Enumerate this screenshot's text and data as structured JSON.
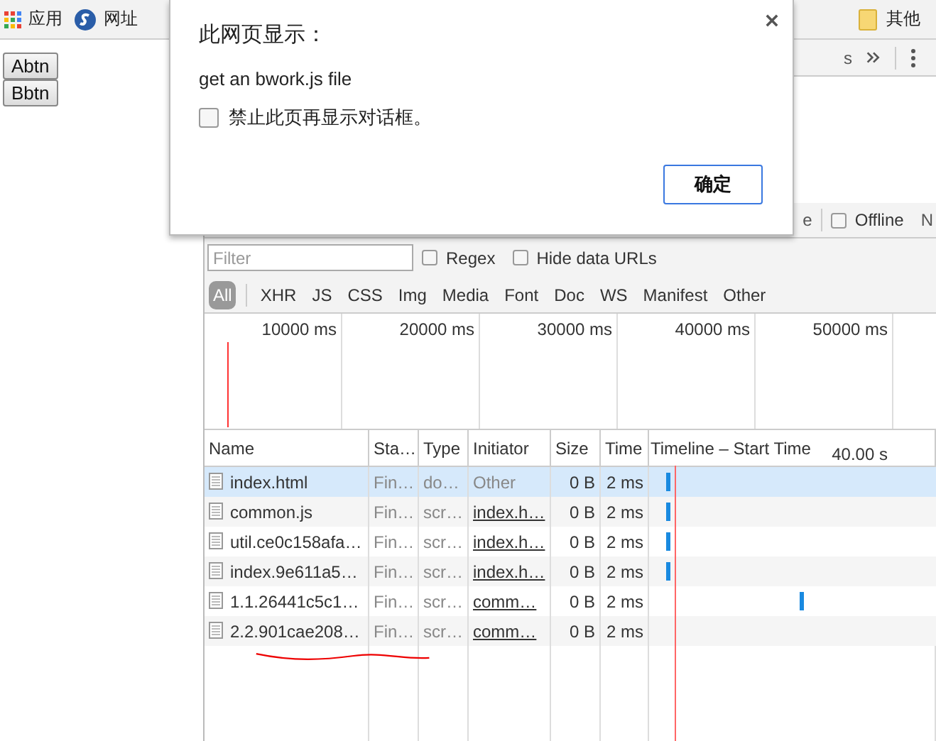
{
  "bookmarks": {
    "left": [
      {
        "kind": "apps",
        "label": "应用"
      },
      {
        "kind": "globe",
        "label": "网址"
      }
    ],
    "right": [
      {
        "kind": "folder",
        "label": "其他"
      }
    ]
  },
  "page_buttons": [
    "Abtn",
    "Bbtn"
  ],
  "devtools": {
    "toolbar": {
      "tab_fragment": "s"
    },
    "throttle": {
      "fragment": "e",
      "offline": {
        "label": "Offline",
        "checked": false
      },
      "next_fragment": "N"
    },
    "filter": {
      "placeholder": "Filter",
      "regex": {
        "label": "Regex",
        "checked": false
      },
      "hide_data_urls": {
        "label": "Hide data URLs",
        "checked": false
      }
    },
    "types": [
      {
        "label": "All",
        "selected": true
      },
      {
        "label": "XHR",
        "selected": false
      },
      {
        "label": "JS",
        "selected": false
      },
      {
        "label": "CSS",
        "selected": false
      },
      {
        "label": "Img",
        "selected": false
      },
      {
        "label": "Media",
        "selected": false
      },
      {
        "label": "Font",
        "selected": false
      },
      {
        "label": "Doc",
        "selected": false
      },
      {
        "label": "WS",
        "selected": false
      },
      {
        "label": "Manifest",
        "selected": false
      },
      {
        "label": "Other",
        "selected": false
      }
    ],
    "overview": {
      "ticks": [
        "10000 ms",
        "20000 ms",
        "30000 ms",
        "40000 ms",
        "50000 ms"
      ]
    },
    "table": {
      "columns": [
        "Name",
        "Sta…",
        "Type",
        "Initiator",
        "Size",
        "Time",
        "Timeline – Start Time"
      ],
      "timeline_scale": "40.00 s",
      "rows": [
        {
          "name": "index.html",
          "status": "Fin…",
          "type": "do…",
          "initiator": "Other",
          "initiator_link": false,
          "size": "0 B",
          "time": "2 ms",
          "selected": true,
          "kind": "early"
        },
        {
          "name": "common.js",
          "status": "Fin…",
          "type": "scr…",
          "initiator": "index.h…",
          "initiator_link": true,
          "size": "0 B",
          "time": "2 ms",
          "selected": false,
          "kind": "early"
        },
        {
          "name": "util.ce0c158afa…",
          "status": "Fin…",
          "type": "scr…",
          "initiator": "index.h…",
          "initiator_link": true,
          "size": "0 B",
          "time": "2 ms",
          "selected": false,
          "kind": "early"
        },
        {
          "name": "index.9e611a5…",
          "status": "Fin…",
          "type": "scr…",
          "initiator": "index.h…",
          "initiator_link": true,
          "size": "0 B",
          "time": "2 ms",
          "selected": false,
          "kind": "early"
        },
        {
          "name": "1.1.26441c5c1…",
          "status": "Fin…",
          "type": "scr…",
          "initiator": "comm…",
          "initiator_link": true,
          "size": "0 B",
          "time": "2 ms",
          "selected": false,
          "kind": "late"
        },
        {
          "name": "2.2.901cae208…",
          "status": "Fin…",
          "type": "scr…",
          "initiator": "comm…",
          "initiator_link": true,
          "size": "0 B",
          "time": "2 ms",
          "selected": false,
          "kind": "none"
        }
      ]
    }
  },
  "dialog": {
    "title": "此网页显示：",
    "message": "get an bwork.js file",
    "suppress": {
      "label": "禁止此页再显示对话框。",
      "checked": false
    },
    "ok": "确定"
  }
}
